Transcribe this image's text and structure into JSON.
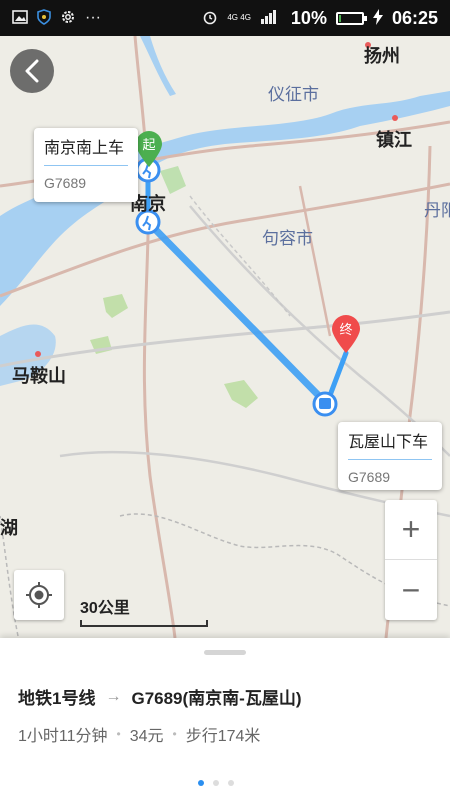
{
  "status_bar": {
    "network": "4G 4G",
    "battery_text": "10%",
    "battery_level": 0.1,
    "time": "06:25"
  },
  "map": {
    "cities": {
      "yangzhou": "扬州",
      "yizheng": "仪征市",
      "zhenjiang": "镇江",
      "danyang": "丹阳",
      "nanjing": "南京",
      "jurong": "句容市",
      "maanshan": "马鞍山",
      "hu": "湖"
    },
    "start_callout": {
      "title": "南京南上车",
      "subtitle": "G7689"
    },
    "end_callout": {
      "title": "瓦屋山下车",
      "subtitle": "G7689"
    },
    "start_marker": "起",
    "end_marker": "终",
    "scale_label": "30公里",
    "zoom_in_label": "+",
    "zoom_out_label": "−",
    "route_color": "#3ea0f5",
    "start_color": "#4caf50",
    "end_color": "#f04b4b"
  },
  "route": {
    "segment_1": "地铁1号线",
    "arrow": "→",
    "segment_2": "G7689(南京南-瓦屋山)",
    "duration": "1小时11分钟",
    "price": "34元",
    "walk": "步行174米",
    "separator": "•"
  },
  "pager": {
    "pages": 3,
    "active": 0
  }
}
